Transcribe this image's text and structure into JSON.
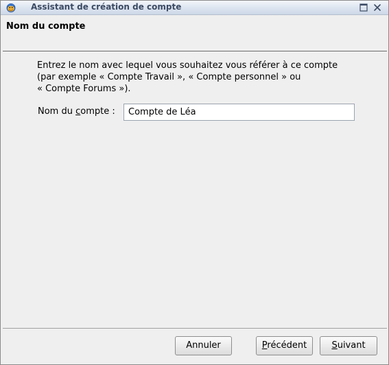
{
  "window": {
    "title": "Assistant de création de compte"
  },
  "page": {
    "title": "Nom du compte",
    "description_lines": [
      "Entrez le nom avec lequel vous souhaitez vous référer à ce compte",
      "(par exemple « Compte Travail », « Compte personnel » ou",
      "« Compte Forums »)."
    ]
  },
  "form": {
    "label_before": "Nom du ",
    "label_mnemonic": "c",
    "label_after": "ompte :",
    "value": "Compte de Léa"
  },
  "buttons": {
    "cancel": "Annuler",
    "back_mnemonic": "P",
    "back_rest": "récédent",
    "next_mnemonic": "S",
    "next_rest": "uivant"
  },
  "icons": {
    "app": "thunderbird-icon",
    "maximize": "maximize-icon",
    "close": "close-icon"
  }
}
